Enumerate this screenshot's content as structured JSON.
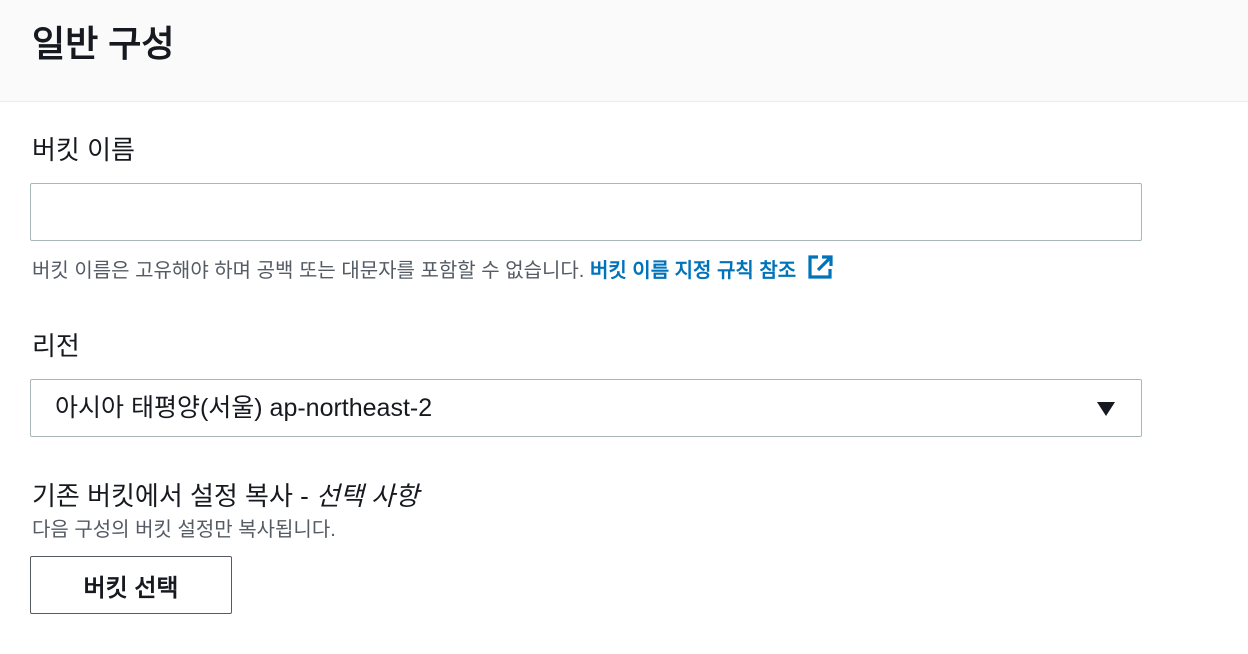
{
  "section": {
    "title": "일반 구성"
  },
  "bucket_name": {
    "label": "버킷 이름",
    "value": "",
    "placeholder": "",
    "hint": "버킷 이름은 고유해야 하며 공백 또는 대문자를 포함할 수 없습니다.",
    "rules_link": "버킷 이름 지정 규칙 참조",
    "rules_link_icon": "external-link-icon"
  },
  "region": {
    "label": "리전",
    "selected": "아시아 태평양(서울) ap-northeast-2",
    "caret_icon": "caret-down-icon"
  },
  "copy_settings": {
    "label": "기존 버킷에서 설정 복사 - ",
    "optional": "선택 사항",
    "hint": "다음 구성의 버킷 설정만 복사됩니다.",
    "button_label": "버킷 선택"
  },
  "colors": {
    "link": "#0073bb",
    "text": "#16191f",
    "secondary_text": "#545b64",
    "header_bg": "#fafafa",
    "border": "#aab7b8"
  }
}
